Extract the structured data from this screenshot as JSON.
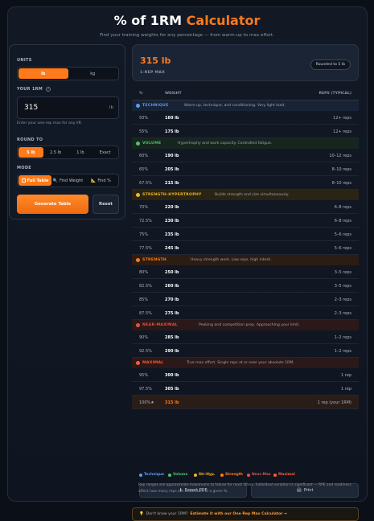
{
  "header": {
    "title_main": "% of 1RM",
    "title_accent": "Calculator",
    "subtitle": "Find your training weights for any percentage — from warm-up to max effort."
  },
  "form": {
    "units_label": "UNITS",
    "units": [
      {
        "label": "lb",
        "active": true
      },
      {
        "label": "kg",
        "active": false
      }
    ],
    "rm_label": "YOUR 1RM",
    "rm_value": "315",
    "rm_unit": "lb",
    "rm_hint": "Enter your one-rep max for any lift.",
    "round_label": "ROUND TO",
    "round": [
      {
        "label": "5 lb",
        "active": true
      },
      {
        "label": "2.5 lb",
        "active": false
      },
      {
        "label": "1 lb",
        "active": false
      },
      {
        "label": "Exact",
        "active": false
      }
    ],
    "mode_label": "MODE",
    "modes": [
      {
        "label": "Full Table",
        "active": true,
        "icon": "table-icon"
      },
      {
        "label": "Find Weight",
        "active": false,
        "icon": "search-icon"
      },
      {
        "label": "Find %",
        "active": false,
        "icon": "ruler-icon"
      }
    ],
    "generate_label": "Generate Table",
    "reset_label": "Reset"
  },
  "result": {
    "value": "315 lb",
    "caption": "1-REP MAX",
    "rounding_badge": "Rounded to 5 lb"
  },
  "table": {
    "headers": {
      "pct": "%",
      "weight": "WEIGHT",
      "reps": "REPS (TYPICAL)"
    },
    "zones": [
      {
        "name": "TECHNIQUE",
        "desc": "Warm-up, technique, and conditioning. Very light load.",
        "color": "#5b9cf0",
        "bg": "#182436",
        "rows": [
          {
            "pct": "50%",
            "weight": "160 lb",
            "reps": "12+ reps"
          },
          {
            "pct": "55%",
            "weight": "175 lb",
            "reps": "12+ reps"
          }
        ]
      },
      {
        "name": "VOLUME",
        "desc": "Hypertrophy and work capacity. Controlled fatigue.",
        "color": "#4cc46a",
        "bg": "#16261e",
        "rows": [
          {
            "pct": "60%",
            "weight": "190 lb",
            "reps": "10–12 reps"
          },
          {
            "pct": "65%",
            "weight": "205 lb",
            "reps": "8–10 reps"
          },
          {
            "pct": "67.5%",
            "weight": "215 lb",
            "reps": "8–10 reps"
          }
        ]
      },
      {
        "name": "STRENGTH-HYPERTROPHY",
        "desc": "Builds strength and size simultaneously.",
        "color": "#f0b429",
        "bg": "#2a2414",
        "rows": [
          {
            "pct": "70%",
            "weight": "220 lb",
            "reps": "6–8 reps"
          },
          {
            "pct": "72.5%",
            "weight": "230 lb",
            "reps": "6–8 reps"
          },
          {
            "pct": "75%",
            "weight": "235 lb",
            "reps": "5–6 reps"
          },
          {
            "pct": "77.5%",
            "weight": "245 lb",
            "reps": "5–6 reps"
          }
        ]
      },
      {
        "name": "STRENGTH",
        "desc": "Heavy strength work. Low reps, high intent.",
        "color": "#ff7a1a",
        "bg": "#2b1d14",
        "rows": [
          {
            "pct": "80%",
            "weight": "250 lb",
            "reps": "3–5 reps"
          },
          {
            "pct": "82.5%",
            "weight": "260 lb",
            "reps": "3–5 reps"
          },
          {
            "pct": "85%",
            "weight": "270 lb",
            "reps": "2–3 reps"
          },
          {
            "pct": "87.5%",
            "weight": "275 lb",
            "reps": "2–3 reps"
          }
        ]
      },
      {
        "name": "NEAR-MAXIMAL",
        "desc": "Peaking and competition prep. Approaching your limit.",
        "color": "#e0524a",
        "bg": "#2b1819",
        "rows": [
          {
            "pct": "90%",
            "weight": "285 lb",
            "reps": "1–2 reps"
          },
          {
            "pct": "92.5%",
            "weight": "290 lb",
            "reps": "1–2 reps"
          }
        ]
      },
      {
        "name": "MAXIMAL",
        "desc": "True max effort. Single reps at or near your absolute 1RM.",
        "color": "#ff5a3a",
        "bg": "#2b1818",
        "rows": [
          {
            "pct": "95%",
            "weight": "300 lb",
            "reps": "1 rep"
          },
          {
            "pct": "97.5%",
            "weight": "305 lb",
            "reps": "1 rep"
          },
          {
            "pct": "100%★",
            "weight": "315 lb",
            "reps": "1 rep (your 1RM)",
            "final": true
          }
        ]
      }
    ]
  },
  "legend": [
    {
      "label": "Technique",
      "color": "#5b9cf0"
    },
    {
      "label": "Volume",
      "color": "#4cc46a"
    },
    {
      "label": "Str-Hyp.",
      "color": "#f0b429"
    },
    {
      "label": "Strength",
      "color": "#ff7a1a"
    },
    {
      "label": "Near-Max",
      "color": "#e0524a"
    },
    {
      "label": "Maximal",
      "color": "#ff5a3a"
    }
  ],
  "actions": {
    "export_label": "Export PDF",
    "print_label": "Print"
  },
  "tip": {
    "text": "Don't know your 1RM?",
    "link": "Estimate it with our One Rep Max Calculator →"
  },
  "footnote": "Rep ranges are approximate maximums to failure for most lifters. Individual variation is significant — RPE and readiness affect how many reps are achievable at a given %."
}
